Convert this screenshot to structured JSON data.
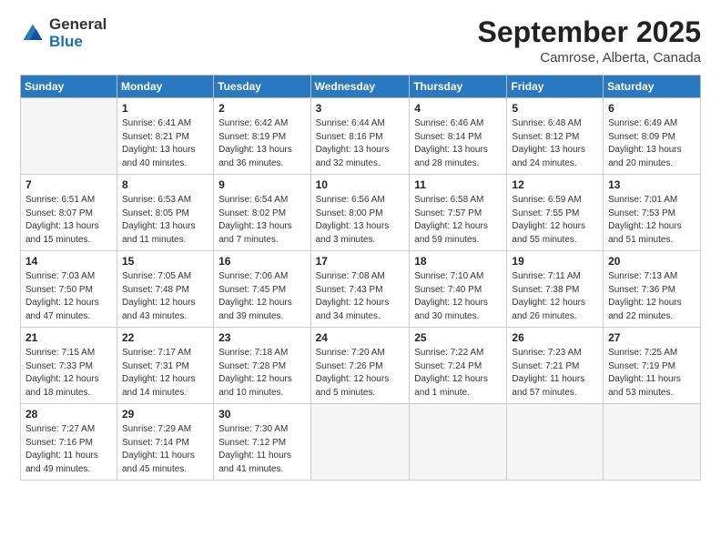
{
  "logo": {
    "general": "General",
    "blue": "Blue"
  },
  "title": "September 2025",
  "location": "Camrose, Alberta, Canada",
  "days_of_week": [
    "Sunday",
    "Monday",
    "Tuesday",
    "Wednesday",
    "Thursday",
    "Friday",
    "Saturday"
  ],
  "weeks": [
    [
      {
        "day": "",
        "empty": true
      },
      {
        "day": "1",
        "sunrise": "Sunrise: 6:41 AM",
        "sunset": "Sunset: 8:21 PM",
        "daylight": "Daylight: 13 hours and 40 minutes."
      },
      {
        "day": "2",
        "sunrise": "Sunrise: 6:42 AM",
        "sunset": "Sunset: 8:19 PM",
        "daylight": "Daylight: 13 hours and 36 minutes."
      },
      {
        "day": "3",
        "sunrise": "Sunrise: 6:44 AM",
        "sunset": "Sunset: 8:16 PM",
        "daylight": "Daylight: 13 hours and 32 minutes."
      },
      {
        "day": "4",
        "sunrise": "Sunrise: 6:46 AM",
        "sunset": "Sunset: 8:14 PM",
        "daylight": "Daylight: 13 hours and 28 minutes."
      },
      {
        "day": "5",
        "sunrise": "Sunrise: 6:48 AM",
        "sunset": "Sunset: 8:12 PM",
        "daylight": "Daylight: 13 hours and 24 minutes."
      },
      {
        "day": "6",
        "sunrise": "Sunrise: 6:49 AM",
        "sunset": "Sunset: 8:09 PM",
        "daylight": "Daylight: 13 hours and 20 minutes."
      }
    ],
    [
      {
        "day": "7",
        "sunrise": "Sunrise: 6:51 AM",
        "sunset": "Sunset: 8:07 PM",
        "daylight": "Daylight: 13 hours and 15 minutes."
      },
      {
        "day": "8",
        "sunrise": "Sunrise: 6:53 AM",
        "sunset": "Sunset: 8:05 PM",
        "daylight": "Daylight: 13 hours and 11 minutes."
      },
      {
        "day": "9",
        "sunrise": "Sunrise: 6:54 AM",
        "sunset": "Sunset: 8:02 PM",
        "daylight": "Daylight: 13 hours and 7 minutes."
      },
      {
        "day": "10",
        "sunrise": "Sunrise: 6:56 AM",
        "sunset": "Sunset: 8:00 PM",
        "daylight": "Daylight: 13 hours and 3 minutes."
      },
      {
        "day": "11",
        "sunrise": "Sunrise: 6:58 AM",
        "sunset": "Sunset: 7:57 PM",
        "daylight": "Daylight: 12 hours and 59 minutes."
      },
      {
        "day": "12",
        "sunrise": "Sunrise: 6:59 AM",
        "sunset": "Sunset: 7:55 PM",
        "daylight": "Daylight: 12 hours and 55 minutes."
      },
      {
        "day": "13",
        "sunrise": "Sunrise: 7:01 AM",
        "sunset": "Sunset: 7:53 PM",
        "daylight": "Daylight: 12 hours and 51 minutes."
      }
    ],
    [
      {
        "day": "14",
        "sunrise": "Sunrise: 7:03 AM",
        "sunset": "Sunset: 7:50 PM",
        "daylight": "Daylight: 12 hours and 47 minutes."
      },
      {
        "day": "15",
        "sunrise": "Sunrise: 7:05 AM",
        "sunset": "Sunset: 7:48 PM",
        "daylight": "Daylight: 12 hours and 43 minutes."
      },
      {
        "day": "16",
        "sunrise": "Sunrise: 7:06 AM",
        "sunset": "Sunset: 7:45 PM",
        "daylight": "Daylight: 12 hours and 39 minutes."
      },
      {
        "day": "17",
        "sunrise": "Sunrise: 7:08 AM",
        "sunset": "Sunset: 7:43 PM",
        "daylight": "Daylight: 12 hours and 34 minutes."
      },
      {
        "day": "18",
        "sunrise": "Sunrise: 7:10 AM",
        "sunset": "Sunset: 7:40 PM",
        "daylight": "Daylight: 12 hours and 30 minutes."
      },
      {
        "day": "19",
        "sunrise": "Sunrise: 7:11 AM",
        "sunset": "Sunset: 7:38 PM",
        "daylight": "Daylight: 12 hours and 26 minutes."
      },
      {
        "day": "20",
        "sunrise": "Sunrise: 7:13 AM",
        "sunset": "Sunset: 7:36 PM",
        "daylight": "Daylight: 12 hours and 22 minutes."
      }
    ],
    [
      {
        "day": "21",
        "sunrise": "Sunrise: 7:15 AM",
        "sunset": "Sunset: 7:33 PM",
        "daylight": "Daylight: 12 hours and 18 minutes."
      },
      {
        "day": "22",
        "sunrise": "Sunrise: 7:17 AM",
        "sunset": "Sunset: 7:31 PM",
        "daylight": "Daylight: 12 hours and 14 minutes."
      },
      {
        "day": "23",
        "sunrise": "Sunrise: 7:18 AM",
        "sunset": "Sunset: 7:28 PM",
        "daylight": "Daylight: 12 hours and 10 minutes."
      },
      {
        "day": "24",
        "sunrise": "Sunrise: 7:20 AM",
        "sunset": "Sunset: 7:26 PM",
        "daylight": "Daylight: 12 hours and 5 minutes."
      },
      {
        "day": "25",
        "sunrise": "Sunrise: 7:22 AM",
        "sunset": "Sunset: 7:24 PM",
        "daylight": "Daylight: 12 hours and 1 minute."
      },
      {
        "day": "26",
        "sunrise": "Sunrise: 7:23 AM",
        "sunset": "Sunset: 7:21 PM",
        "daylight": "Daylight: 11 hours and 57 minutes."
      },
      {
        "day": "27",
        "sunrise": "Sunrise: 7:25 AM",
        "sunset": "Sunset: 7:19 PM",
        "daylight": "Daylight: 11 hours and 53 minutes."
      }
    ],
    [
      {
        "day": "28",
        "sunrise": "Sunrise: 7:27 AM",
        "sunset": "Sunset: 7:16 PM",
        "daylight": "Daylight: 11 hours and 49 minutes."
      },
      {
        "day": "29",
        "sunrise": "Sunrise: 7:29 AM",
        "sunset": "Sunset: 7:14 PM",
        "daylight": "Daylight: 11 hours and 45 minutes."
      },
      {
        "day": "30",
        "sunrise": "Sunrise: 7:30 AM",
        "sunset": "Sunset: 7:12 PM",
        "daylight": "Daylight: 11 hours and 41 minutes."
      },
      {
        "day": "",
        "empty": true
      },
      {
        "day": "",
        "empty": true
      },
      {
        "day": "",
        "empty": true
      },
      {
        "day": "",
        "empty": true
      }
    ]
  ]
}
